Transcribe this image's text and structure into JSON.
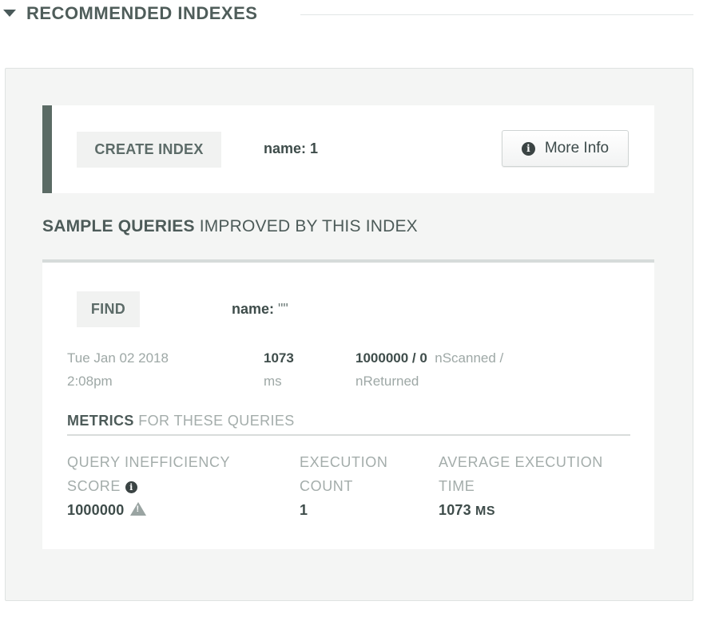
{
  "section": {
    "title": "RECOMMENDED INDEXES"
  },
  "index": {
    "action_label": "CREATE INDEX",
    "spec": "name: 1",
    "more_info_label": "More Info",
    "more_info_icon": "info-circle-icon"
  },
  "sample_queries": {
    "heading_strong": "SAMPLE QUERIES",
    "heading_rest": " IMPROVED BY THIS INDEX"
  },
  "query": {
    "operation": "FIND",
    "filter_key": "name:",
    "filter_value": "\"\"",
    "date_line1": "Tue Jan 02 2018",
    "date_line2": "2:08pm",
    "duration": "1073",
    "duration_unit": "ms",
    "scanned_returned": "1000000 / 0",
    "scanned_label_1": "nScanned /",
    "scanned_label_2": "nReturned"
  },
  "metrics": {
    "heading_strong": "METRICS",
    "heading_rest": " FOR THESE QUERIES",
    "inefficiency_label_1": "QUERY INEFFICIENCY",
    "inefficiency_label_2": "SCORE",
    "inefficiency_value": "1000000",
    "execution_count_label_1": "EXECUTION",
    "execution_count_label_2": "COUNT",
    "execution_count_value": "1",
    "avg_time_label_1": "AVERAGE EXECUTION",
    "avg_time_label_2": "TIME",
    "avg_time_value": "1073",
    "avg_time_unit": "MS"
  },
  "colors": {
    "accent_bar": "#5b6b65",
    "panel_bg": "#f4f5f4",
    "tag_bg": "#f1f2f1",
    "muted_text": "#9ea8a6",
    "strong_text": "#3f4d4b"
  }
}
